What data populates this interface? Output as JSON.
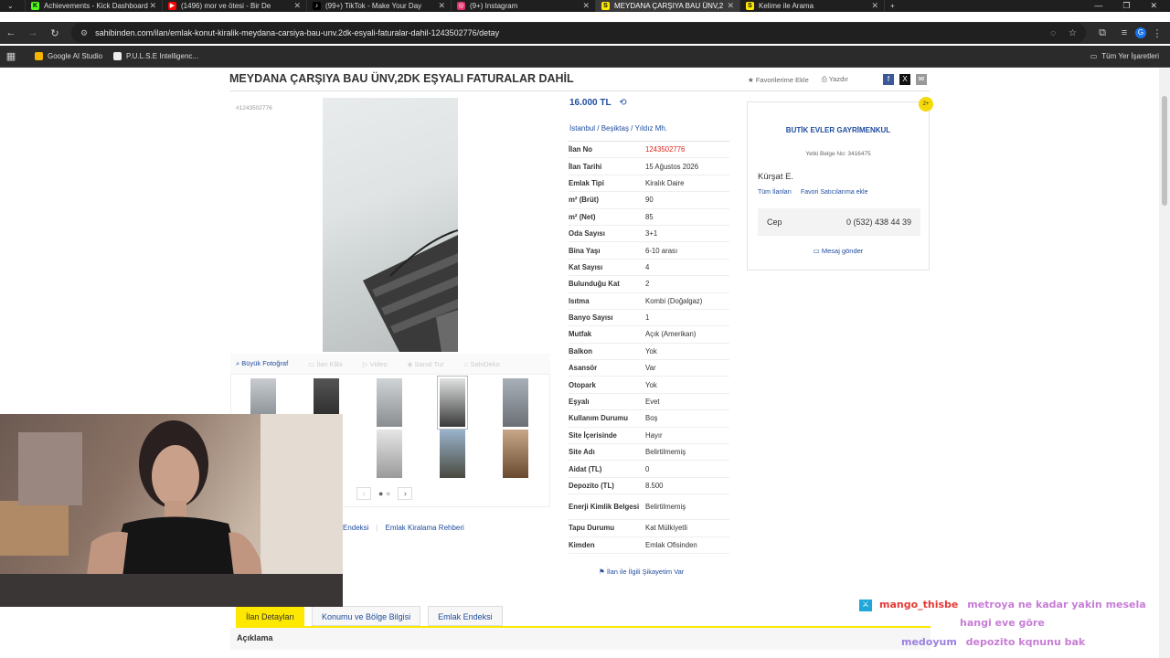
{
  "browser": {
    "tabs": [
      {
        "label": "Achievements - Kick Dashboard",
        "icon": "kick-icon",
        "color": "#53fc18"
      },
      {
        "label": "(1496) mor ve ötesi - Bir De",
        "icon": "youtube-icon",
        "color": "#ff0000"
      },
      {
        "label": "(99+) TikTok - Make Your Day",
        "icon": "tiktok-icon",
        "color": "#ffffff"
      },
      {
        "label": "(9+) Instagram",
        "icon": "instagram-icon",
        "color": "#e1306c"
      },
      {
        "label": "MEYDANA ÇARŞIYA BAU ÜNV,2",
        "icon": "sahibinden-icon",
        "color": "#ffe800",
        "active": true
      },
      {
        "label": "Kelime ile Arama",
        "icon": "sahibinden-icon",
        "color": "#ffe800"
      }
    ],
    "url": "sahibinden.com/ilan/emlak-konut-kiralik-meydana-carsiya-bau-unv.2dk-esyali-faturalar-dahil-1243502776/detay",
    "bookmarks": [
      "Google AI Studio",
      "P.U.L.S.E Intelligenc..."
    ],
    "bookmarks_right": "Tüm Yer İşaretleri",
    "profile_initial": "G"
  },
  "listing": {
    "title": "MEYDANA ÇARŞIYA BAU ÜNV,2DK EŞYALI FATURALAR DAHİL",
    "favorite_label": "Favorilerime Ekle",
    "print_label": "Yazdır",
    "listing_id": "#1243502776",
    "price": "16.000 TL",
    "breadcrumb": [
      "İstanbul",
      "Beşiktaş",
      "Yıldız Mh."
    ],
    "photo_tabs": [
      "Büyük Fotoğraf",
      "İlan Klibi",
      "Video",
      "Sanal Tur",
      "SahiDeko"
    ],
    "details": [
      {
        "k": "İlan No",
        "v": "1243502776",
        "red": true
      },
      {
        "k": "İlan Tarihi",
        "v": "15 Ağustos 2026"
      },
      {
        "k": "Emlak Tipi",
        "v": "Kiralık Daire"
      },
      {
        "k": "m² (Brüt)",
        "v": "90"
      },
      {
        "k": "m² (Net)",
        "v": "85"
      },
      {
        "k": "Oda Sayısı",
        "v": "3+1"
      },
      {
        "k": "Bina Yaşı",
        "v": "6-10 arası"
      },
      {
        "k": "Kat Sayısı",
        "v": "4"
      },
      {
        "k": "Bulunduğu Kat",
        "v": "2"
      },
      {
        "k": "Isıtma",
        "v": "Kombi (Doğalgaz)"
      },
      {
        "k": "Banyo Sayısı",
        "v": "1"
      },
      {
        "k": "Mutfak",
        "v": "Açık (Amerikan)"
      },
      {
        "k": "Balkon",
        "v": "Yok"
      },
      {
        "k": "Asansör",
        "v": "Var"
      },
      {
        "k": "Otopark",
        "v": "Yok"
      },
      {
        "k": "Eşyalı",
        "v": "Evet"
      },
      {
        "k": "Kullanım Durumu",
        "v": "Boş"
      },
      {
        "k": "Site İçerisinde",
        "v": "Hayır"
      },
      {
        "k": "Site Adı",
        "v": "Belirtilmemiş"
      },
      {
        "k": "Aidat (TL)",
        "v": "0"
      },
      {
        "k": "Depozito (TL)",
        "v": "8.500"
      },
      {
        "k": "Enerji Kimlik Belgesi",
        "v": "Belirtilmemiş",
        "tall": true
      },
      {
        "k": "Tapu Durumu",
        "v": "Kat Mülkiyetli"
      },
      {
        "k": "Kimden",
        "v": "Emlak Ofisinden"
      }
    ],
    "complain_label": "İlan ile İlgili Şikayetim Var",
    "bottom_links": [
      "Endeksi",
      "Emlak Kiralama Rehberi"
    ],
    "bottom_tabs": [
      "İlan Detayları",
      "Konumu ve Bölge Bilgisi",
      "Emlak Endeksi"
    ],
    "description_header": "Açıklama"
  },
  "seller": {
    "agency": "BUTİK EVLER GAYRİMENKUL",
    "license": "Yetki Belge No: 3416475",
    "agent": "Kürşat E.",
    "links": [
      "Tüm İlanları",
      "Favori Satıcılarıma ekle"
    ],
    "phone_label": "Cep",
    "phone": "0 (532) 438 44 39",
    "message_label": "Mesaj gönder"
  },
  "chat": {
    "user1": "mango_thisbe",
    "msg1_line1": "metroya ne kadar yakin mesela",
    "msg1_line2": "hangi eve göre",
    "user2": "medoyum",
    "msg2": "depozito kqnunu bak"
  }
}
